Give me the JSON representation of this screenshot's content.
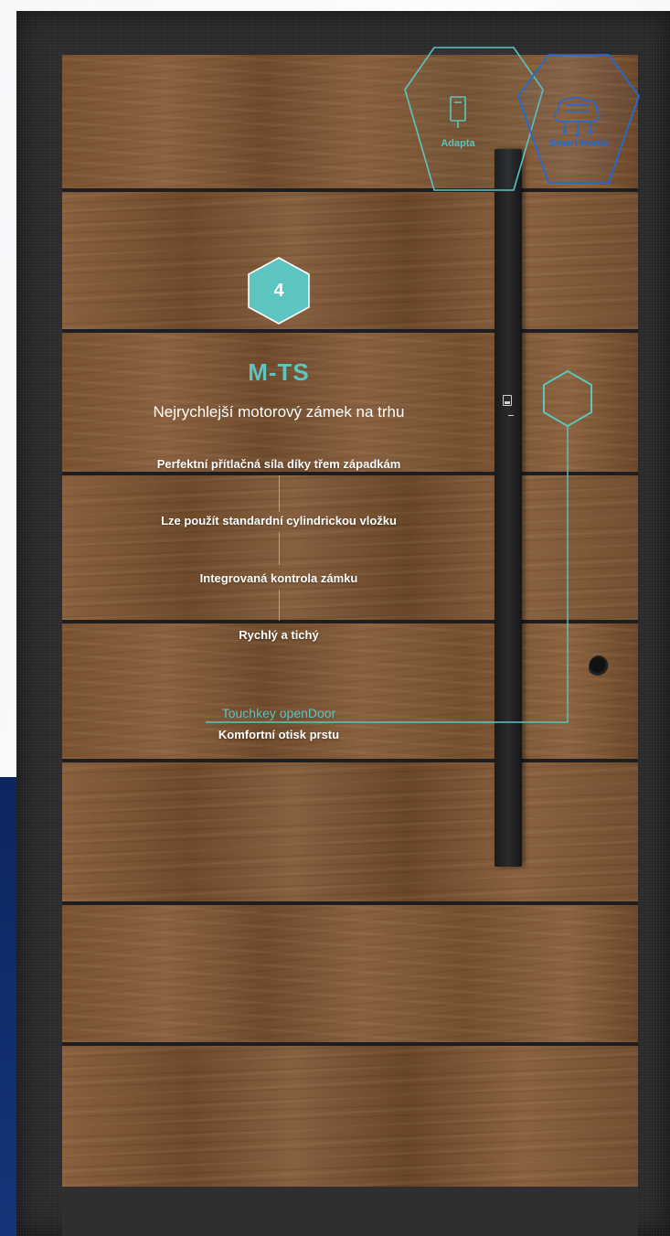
{
  "product": {
    "step_number": "4",
    "title": "M-TS",
    "subtitle": "Nejrychlejší motorový zámek na trhu"
  },
  "features": [
    "Perfektní přítlačná síla díky třem západkám",
    "Lze použít standardní cylindrickou vložku",
    "Integrovaná kontrola zámku",
    "Rychlý a tichý"
  ],
  "touchkey": {
    "label": "Touchkey openDoor",
    "description": "Komfortní otisk prstu"
  },
  "badges": [
    {
      "label": "Adapta",
      "icon": "door-handle-icon",
      "color": "#5cc5c0"
    },
    {
      "label": "Smart Home",
      "icon": "brain-circuit-icon",
      "color": "#1f6bd6"
    }
  ],
  "colors": {
    "accent_teal": "#5cc5c0",
    "accent_blue": "#1f6bd6",
    "frame": "#2a2a2c",
    "navy": "#0c2660"
  }
}
